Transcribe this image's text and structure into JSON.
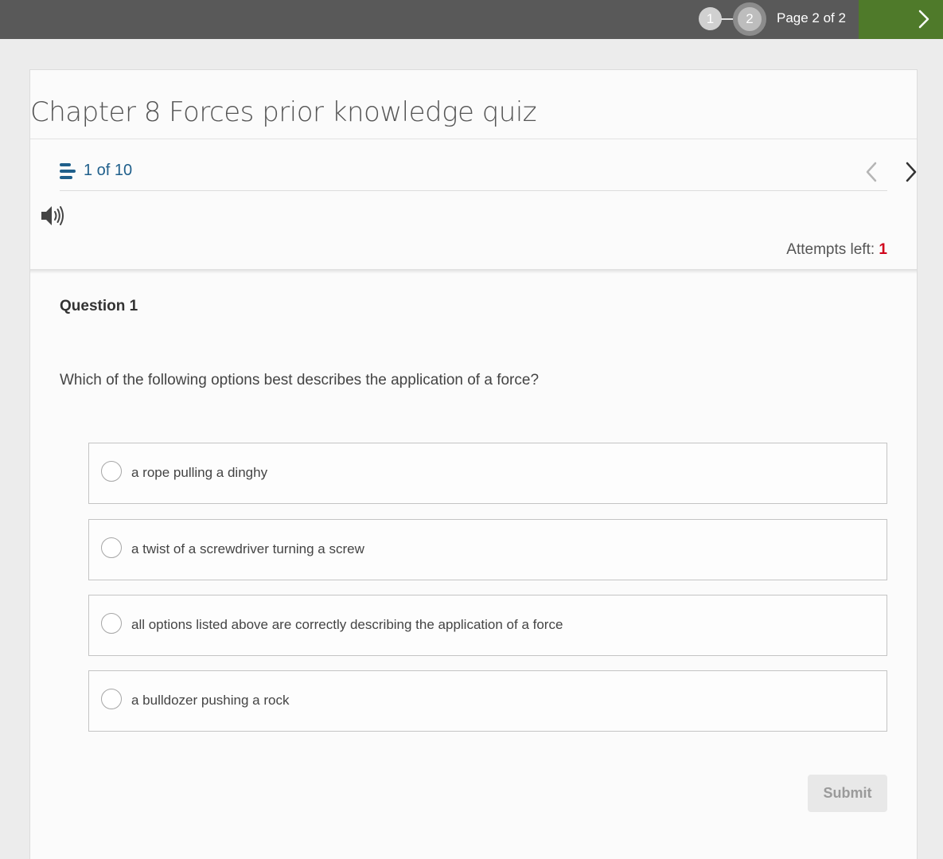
{
  "pager": {
    "steps": [
      "1",
      "2"
    ],
    "current_step": 2,
    "page_label": "Page 2 of 2"
  },
  "quiz": {
    "title": "Chapter 8 Forces prior knowledge quiz",
    "counter": "1 of 10",
    "attempts_label": "Attempts left:",
    "attempts_count": "1"
  },
  "question": {
    "label": "Question 1",
    "text": "Which of the following options best describes the application of a force?",
    "options": [
      "a rope pulling a dinghy",
      "a twist of a screwdriver turning a screw",
      "all options listed above are correctly describing the application of a force",
      "a bulldozer pushing a rock"
    ],
    "submit_label": "Submit"
  },
  "colors": {
    "topbar": "#595959",
    "next_button": "#4f7a2a",
    "link_blue": "#1f5f8b",
    "attempts_red": "#d0021b"
  },
  "icons": {
    "list": "list-icon",
    "prev": "chevron-left-icon",
    "next": "chevron-right-icon",
    "audio": "speaker-icon",
    "next_page": "chevron-right-icon"
  }
}
